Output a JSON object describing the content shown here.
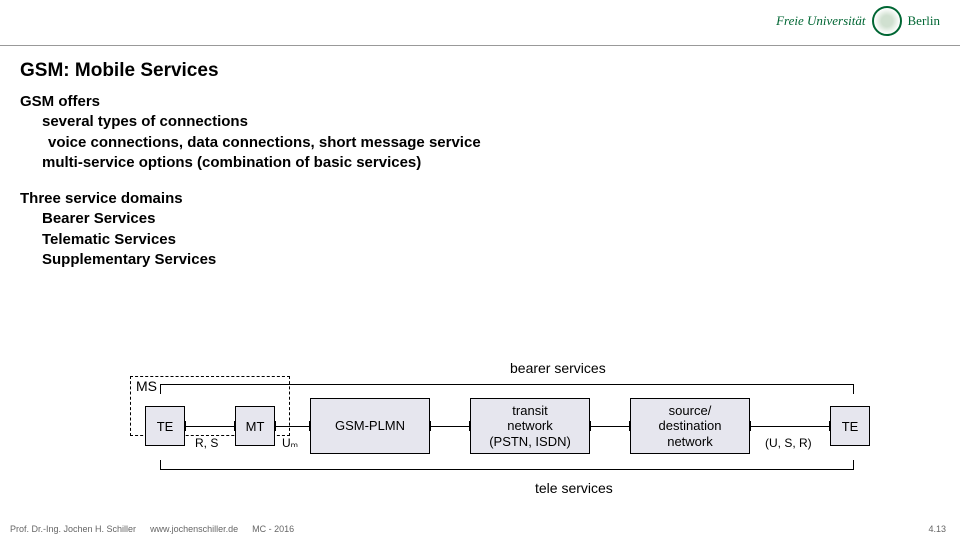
{
  "header": {
    "fu_text": "Freie Universität",
    "berlin": "Berlin"
  },
  "title": "GSM: Mobile Services",
  "body": {
    "l1": "GSM offers",
    "l2": "several types of connections",
    "l3": "voice connections, data connections, short message service",
    "l4": "multi-service options (combination of basic services)",
    "l5": "Three service domains",
    "l6": "Bearer Services",
    "l7": "Telematic Services",
    "l8": "Supplementary Services"
  },
  "diagram": {
    "bearer_label": "bearer services",
    "tele_label": "tele services",
    "ms": "MS",
    "te": "TE",
    "mt": "MT",
    "gsm_plmn": "GSM-PLMN",
    "transit": "transit\nnetwork\n(PSTN, ISDN)",
    "srcdst": "source/\ndestination\nnetwork",
    "rs": "R, S",
    "um": "Uₘ",
    "usr": "(U, S, R)"
  },
  "footer": {
    "author": "Prof. Dr.-Ing. Jochen H. Schiller",
    "site": "www.jochenschiller.de",
    "course": "MC - 2016",
    "page": "4.13"
  }
}
